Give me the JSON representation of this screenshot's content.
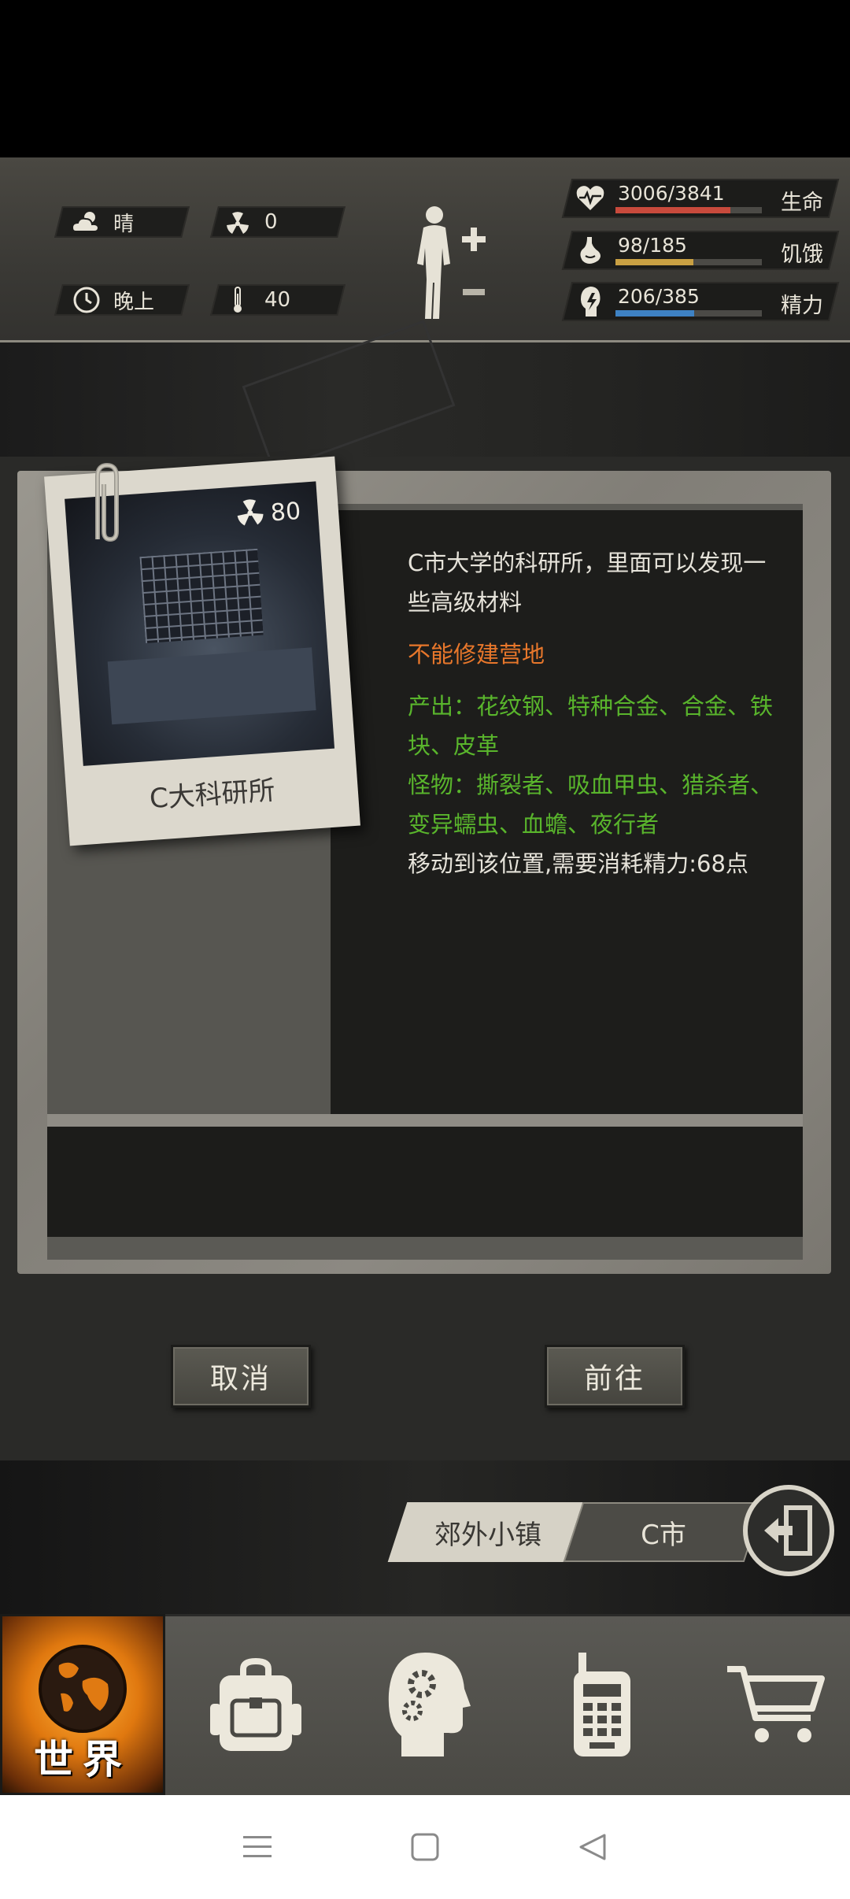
{
  "status": {
    "weather": "晴",
    "radiation": "0",
    "time_of_day": "晚上",
    "temperature": "40"
  },
  "stats": [
    {
      "value": "3006/3841",
      "label": "生命",
      "fraction": 0.783,
      "color": "#c84a3c",
      "icon": "heart-icon"
    },
    {
      "value": "98/185",
      "label": "饥饿",
      "fraction": 0.53,
      "color": "#c9a043",
      "icon": "stomach-icon"
    },
    {
      "value": "206/385",
      "label": "精力",
      "fraction": 0.535,
      "color": "#3e82c4",
      "icon": "energy-icon"
    }
  ],
  "location": {
    "name": "C大科研所",
    "radiation": "80",
    "description": "C市大学的科研所，里面可以发现一些高级材料",
    "warning": "不能修建营地",
    "output": "产出：花纹钢、特种合金、合金、铁块、皮革",
    "monsters": "怪物：撕裂者、吸血甲虫、猎杀者、变异蠕虫、血蟾、夜行者",
    "move_cost": "移动到该位置,需要消耗精力:68点"
  },
  "buttons": {
    "cancel": "取消",
    "go": "前往"
  },
  "location_tabs": {
    "suburb": "郊外小镇",
    "city": "C市"
  },
  "nav": {
    "world": "世界"
  }
}
